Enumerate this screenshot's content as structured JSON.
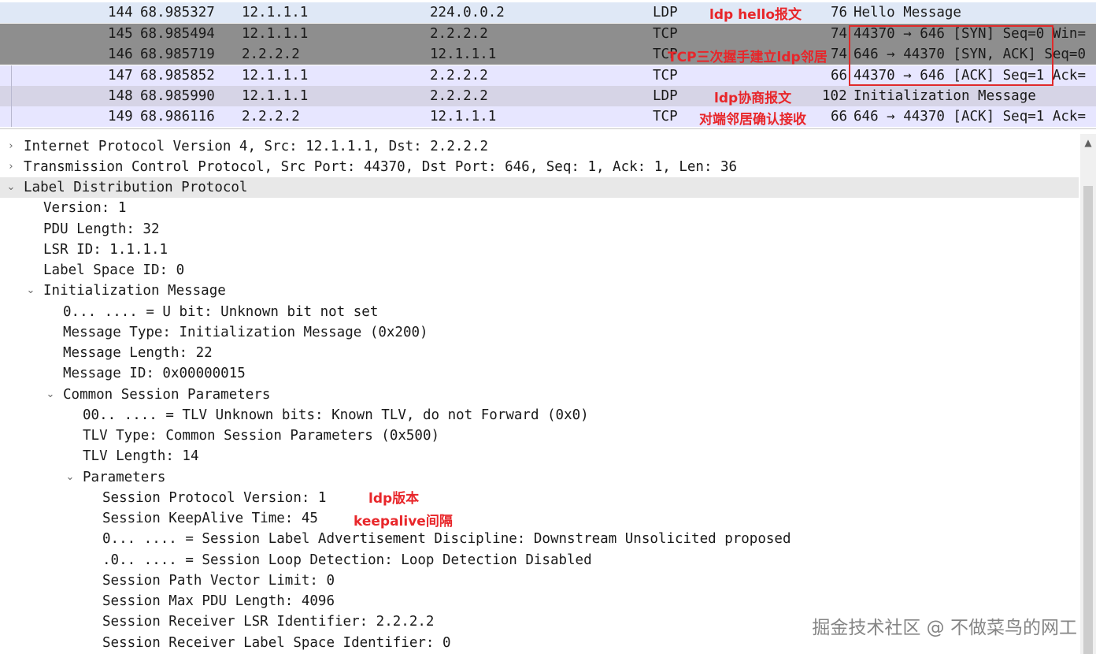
{
  "packets": [
    {
      "no": "144",
      "time": "68.985327",
      "src": "12.1.1.1",
      "dst": "224.0.0.2",
      "proto": "LDP",
      "len": "76",
      "info": "Hello Message"
    },
    {
      "no": "145",
      "time": "68.985494",
      "src": "12.1.1.1",
      "dst": "2.2.2.2",
      "proto": "TCP",
      "len": "74",
      "info": "44370 → 646 [SYN] Seq=0 Win="
    },
    {
      "no": "146",
      "time": "68.985719",
      "src": "2.2.2.2",
      "dst": "12.1.1.1",
      "proto": "TCP",
      "len": "74",
      "info": "646 → 44370 [SYN, ACK] Seq=0"
    },
    {
      "no": "147",
      "time": "68.985852",
      "src": "12.1.1.1",
      "dst": "2.2.2.2",
      "proto": "TCP",
      "len": "66",
      "info": "44370 → 646 [ACK] Seq=1 Ack="
    },
    {
      "no": "148",
      "time": "68.985990",
      "src": "12.1.1.1",
      "dst": "2.2.2.2",
      "proto": "LDP",
      "len": "102",
      "info": "Initialization Message"
    },
    {
      "no": "149",
      "time": "68.986116",
      "src": "2.2.2.2",
      "dst": "12.1.1.1",
      "proto": "TCP",
      "len": "66",
      "info": "646 → 44370 [ACK] Seq=1 Ack="
    }
  ],
  "annotations": {
    "hello": "ldp hello报文",
    "handshake": "TCP三次握手建立ldp邻居",
    "negotiate": "ldp协商报文",
    "confirm": "对端邻居确认接收",
    "version": "ldp版本",
    "keepalive": "keepalive间隔"
  },
  "tree": [
    {
      "text": "Internet Protocol Version 4, Src: 12.1.1.1, Dst: 2.2.2.2",
      "arrow": "›"
    },
    {
      "text": "Transmission Control Protocol, Src Port: 44370, Dst Port: 646, Seq: 1, Ack: 1, Len: 36",
      "arrow": "›"
    },
    {
      "text": "Label Distribution Protocol",
      "arrow": "⌄"
    },
    {
      "text": "Version: 1"
    },
    {
      "text": "PDU Length: 32"
    },
    {
      "text": "LSR ID: 1.1.1.1"
    },
    {
      "text": "Label Space ID: 0"
    },
    {
      "text": "Initialization Message",
      "arrow": "⌄"
    },
    {
      "text": "0... .... = U bit: Unknown bit not set"
    },
    {
      "text": "Message Type: Initialization Message (0x200)"
    },
    {
      "text": "Message Length: 22"
    },
    {
      "text": "Message ID: 0x00000015"
    },
    {
      "text": "Common Session Parameters",
      "arrow": "⌄"
    },
    {
      "text": "00.. .... = TLV Unknown bits: Known TLV, do not Forward (0x0)"
    },
    {
      "text": "TLV Type: Common Session Parameters (0x500)"
    },
    {
      "text": "TLV Length: 14"
    },
    {
      "text": "Parameters",
      "arrow": "⌄"
    },
    {
      "text": "Session Protocol Version: 1"
    },
    {
      "text": "Session KeepAlive Time: 45"
    },
    {
      "text": "0... .... = Session Label Advertisement Discipline: Downstream Unsolicited proposed"
    },
    {
      "text": ".0.. .... = Session Loop Detection: Loop Detection Disabled"
    },
    {
      "text": "Session Path Vector Limit: 0"
    },
    {
      "text": "Session Max PDU Length: 4096"
    },
    {
      "text": "Session Receiver LSR Identifier: 2.2.2.2"
    },
    {
      "text": "Session Receiver Label Space Identifier: 0"
    }
  ],
  "watermark": "掘金技术社区 @ 不做菜鸟的网工",
  "colors": {
    "annotation": "#e8262a",
    "selected_row": "#8e8e8e",
    "ldp_row": "#dfe8f6",
    "tcp_row": "#e7e6ff"
  }
}
